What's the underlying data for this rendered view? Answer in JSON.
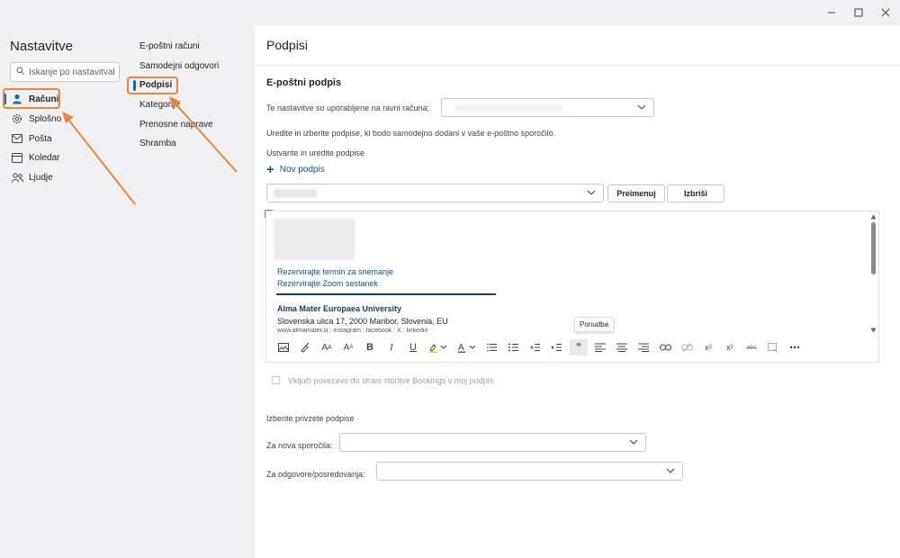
{
  "app": {
    "title": "Nastavitve",
    "search_placeholder": "Iskanje po nastavitval"
  },
  "nav": [
    {
      "label": "Računi",
      "icon": "person-icon"
    },
    {
      "label": "Splošno",
      "icon": "gear-icon"
    },
    {
      "label": "Pošta",
      "icon": "mail-icon"
    },
    {
      "label": "Koledar",
      "icon": "calendar-icon"
    },
    {
      "label": "Ljudje",
      "icon": "people-icon"
    }
  ],
  "subnav": [
    "E-poštni računi",
    "Samodejni odgovori",
    "Podpisi",
    "Kategorije",
    "Prenosne naprave",
    "Shramba"
  ],
  "page": {
    "title": "Podpisi",
    "section_title": "E-poštni podpis",
    "account_label": "Te nastavitve so uporabljene na ravni računa:",
    "description": "Uredite in izberite podpise, ki bodo samodejno dodani v vaše e-poštno sporočilo.",
    "create_label": "Ustvarite in uredite podpise",
    "new_signature": "Nov podpis",
    "rename_button": "Preimenuj",
    "delete_button": "Izbriši",
    "tooltip": "Ponudba",
    "bookings_label": "Vključi povezavo do strani storitve Bookings v moj podpis",
    "defaults_title": "Izberite privzete podpise",
    "new_messages_label": "Za nova sporočila:",
    "replies_label": "Za odgovore/posredovanja:"
  },
  "signature": {
    "link1": "Rezervirajte termin za snemanje",
    "link2": "Rezervirajte Zoom sestanek",
    "org": "Alma Mater Europaea University",
    "address": "Slovenska ulica 17, 2000 Maribor, Slovenia, EU",
    "links": "www.almamater.si : instagram : facebook : X : linkedin"
  },
  "colors": {
    "accent": "#0f6cbd",
    "annotation": "#e8873a",
    "signature_link": "#0f548c"
  }
}
